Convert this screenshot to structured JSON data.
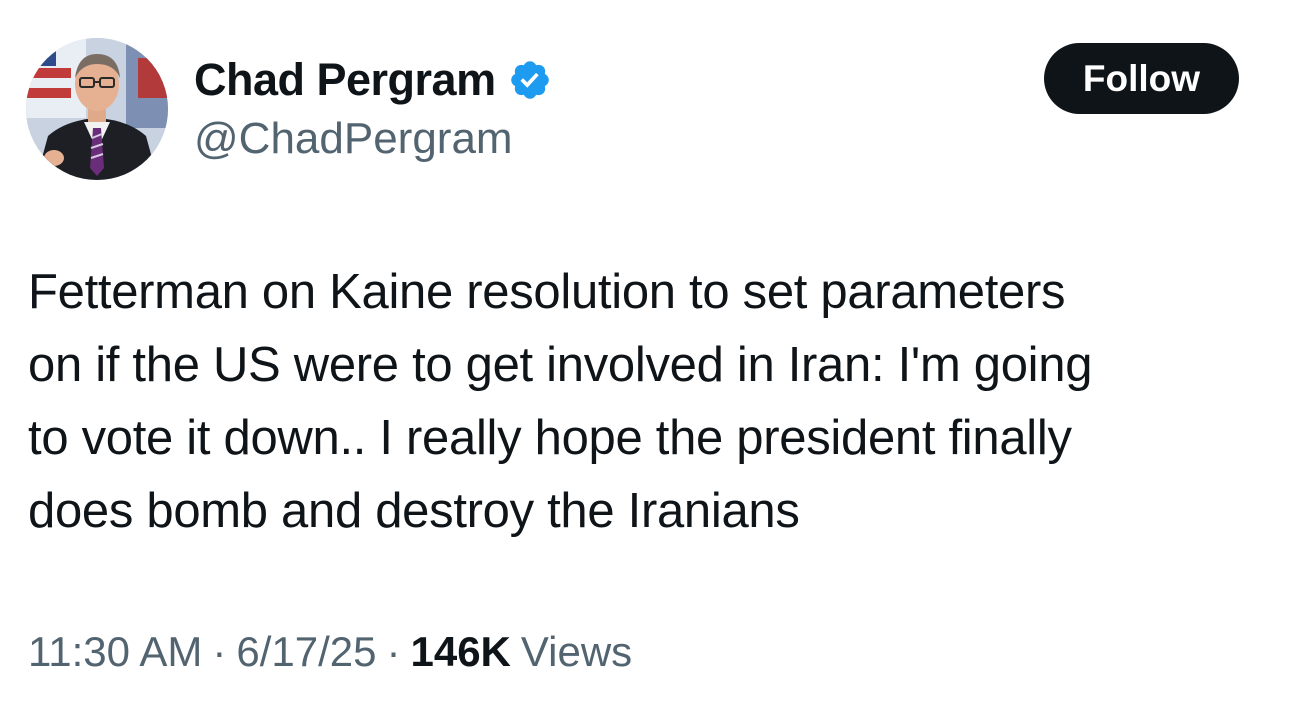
{
  "author": {
    "display_name": "Chad Pergram",
    "handle": "@ChadPergram",
    "verified": true,
    "verified_color": "#1d9bf0"
  },
  "follow_button": {
    "label": "Follow"
  },
  "tweet": {
    "text_lines": [
      "Fetterman on Kaine resolution to set parameters",
      "on if the US were to get involved in Iran: I'm going",
      "to vote it down.. I really hope the president finally",
      "does bomb and destroy the Iranians"
    ]
  },
  "meta": {
    "time": "11:30 AM",
    "separator": "·",
    "date": "6/17/25",
    "views_count": "146K",
    "views_label": "Views"
  },
  "colors": {
    "text_primary": "#0f1419",
    "text_secondary": "#536471",
    "button_bg": "#0f1419",
    "button_text": "#ffffff"
  }
}
